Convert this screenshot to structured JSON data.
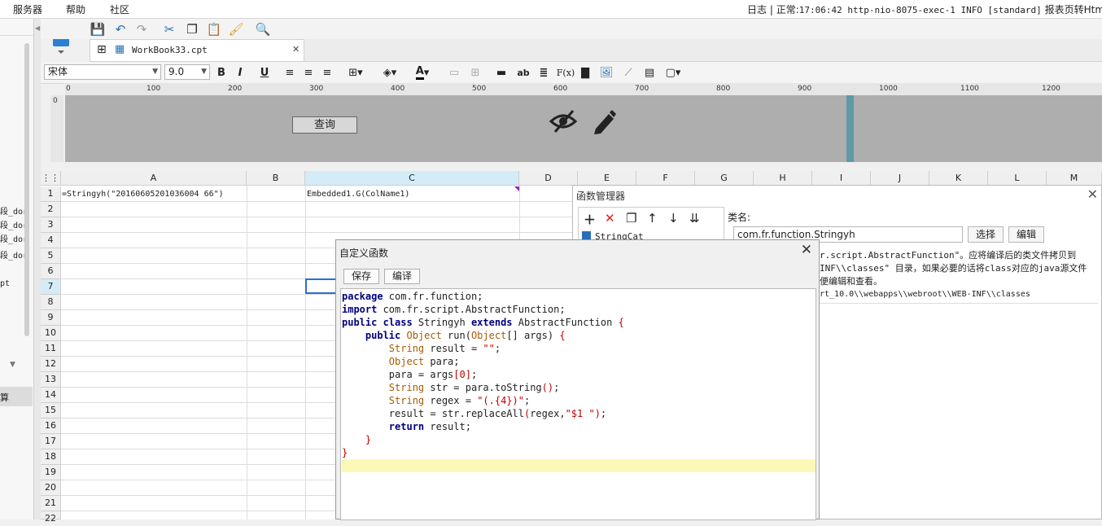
{
  "menubar": {
    "items": [
      "服务器",
      "帮助",
      "社区"
    ],
    "log_label": "日志",
    "log_sep": "|",
    "log_status": "正常:",
    "log_message": "17:06:42 http-nio-8075-exec-1 INFO [standard]",
    "log_tail": "报表页转Html结束"
  },
  "left_panel": {
    "fragments": [
      "段_dor",
      "段_dor",
      "段_dor",
      "段_dor",
      "pt",
      "算"
    ]
  },
  "tab": {
    "label": "WorkBook33.cpt",
    "close": "✕"
  },
  "format_bar": {
    "font_name": "宋体",
    "font_size": "9.0",
    "bold": "B",
    "italic": "I",
    "underline": "U",
    "ab_label": "ab",
    "fx_label": "F(x)"
  },
  "ruler": {
    "ticks": [
      "0",
      "100",
      "200",
      "300",
      "400",
      "500",
      "600",
      "700",
      "800",
      "900",
      "1000",
      "1100",
      "1200"
    ],
    "v_tick": "0"
  },
  "param_panel": {
    "query_button": "查询"
  },
  "sheet": {
    "columns": [
      "A",
      "B",
      "C",
      "D",
      "E",
      "F",
      "G",
      "H",
      "I",
      "J",
      "K",
      "L",
      "M"
    ],
    "rows": [
      "1",
      "2",
      "3",
      "4",
      "5",
      "6",
      "7",
      "8",
      "9",
      "10",
      "11",
      "12",
      "13",
      "14",
      "15",
      "16",
      "17",
      "18",
      "19",
      "20",
      "21",
      "22"
    ],
    "cell_a1": "=Stringyh(\"20160605201036004 66\")",
    "cell_c1": "Embedded1.G(ColName1)"
  },
  "function_manager": {
    "title": "函数管理器",
    "list_item": "StringCat",
    "class_name_label": "类名:",
    "class_name_value": "com.fr.function.Stringyh",
    "select_button": "选择",
    "edit_button": "编辑",
    "desc_line1": "r.script.AbstractFunction\"。应将编译后的类文件拷贝到",
    "desc_line2": "INF\\\\classes\" 目录，如果必要的话将class对应的java源文件",
    "desc_line3": "便编辑和查看。",
    "desc_line4": "rt_10.0\\\\webapps\\\\webroot\\\\WEB-INF\\\\classes"
  },
  "custom_function": {
    "title": "自定义函数",
    "save_button": "保存",
    "compile_button": "编译",
    "code": {
      "l1a": "package",
      "l1b": " com.fr.function;",
      "l2a": "import",
      "l2b": " com.fr.script.AbstractFunction;",
      "l3a": "public class",
      "l3b": " Stringyh ",
      "l3c": "extends",
      "l3d": " AbstractFunction ",
      "l3e": "{",
      "l4a": "    public",
      "l4b": " Object",
      "l4c": " run(",
      "l4d": "Object",
      "l4e": "[] args) ",
      "l4f": "{",
      "l5a": "        String",
      "l5b": " result = ",
      "l5c": "\"\"",
      "l5d": ";",
      "l6a": "        Object",
      "l6b": " para;",
      "l7a": "        para = args",
      "l7b": "[",
      "l7c": "0",
      "l7d": "]",
      "l7e": ";",
      "l8a": "        String",
      "l8b": " str = para.toString",
      "l8c": "()",
      "l8d": ";",
      "l9a": "        String",
      "l9b": " regex = ",
      "l9c": "\"(.{4})\"",
      "l9d": ";",
      "l10a": "        result = str.replaceAll",
      "l10b": "(",
      "l10c": "regex,",
      "l10d": "\"$1 \"",
      "l10e": ")",
      "l10f": ";",
      "l11a": "        return",
      "l11b": " result;",
      "l12": "    }",
      "l13": "}"
    }
  }
}
